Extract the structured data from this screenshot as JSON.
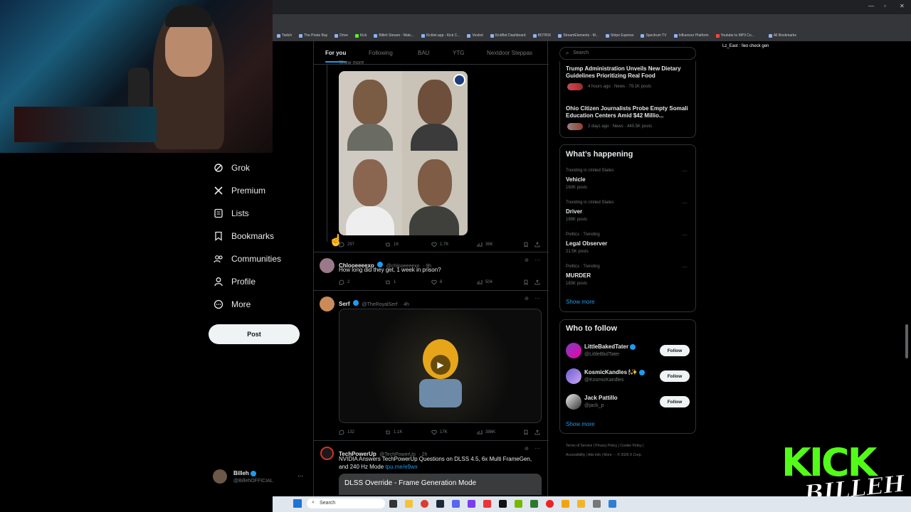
{
  "browser": {
    "bookmarks": [
      "Twitch",
      "The Pirate Bay",
      "Drive",
      "Kick",
      "Billeh Stream - Watc...",
      "Kicklet.app - Kick C...",
      "Voxbot",
      "KickBot Dashboard",
      "BOTRIX",
      "StreamElements - M...",
      "Stripe Express",
      "Spectrum TV",
      "Influencer Platform",
      "Youtube to MP3 Co..."
    ],
    "all_bookmarks": "All Bookmarks"
  },
  "chat": {
    "line": "Lz_East : !leo check gen"
  },
  "nav": {
    "items": [
      {
        "label": "Grok",
        "icon": "grok-icon"
      },
      {
        "label": "Premium",
        "icon": "x-logo-icon"
      },
      {
        "label": "Lists",
        "icon": "list-icon"
      },
      {
        "label": "Bookmarks",
        "icon": "bookmark-icon"
      },
      {
        "label": "Communities",
        "icon": "communities-icon"
      },
      {
        "label": "Profile",
        "icon": "profile-icon"
      },
      {
        "label": "More",
        "icon": "more-circle-icon"
      }
    ],
    "post_label": "Post",
    "profile": {
      "name": "Billeh",
      "handle": "@BillehOFFICIAL"
    }
  },
  "tabs": [
    "For you",
    "Following",
    "BAU",
    "YTG",
    "Nextdoor Steppas"
  ],
  "posts": {
    "first": {
      "show_more": "Show more",
      "replies": "297",
      "reposts": "1K",
      "likes": "1.7K",
      "views": "36K"
    },
    "second": {
      "name": "Chlooeeeexo",
      "handle": "@chlooeeeexo",
      "time": "· 9h",
      "text": "How long did they get, 1 week in prison?",
      "replies": "2",
      "reposts": "1",
      "likes": "6",
      "views": "504"
    },
    "third": {
      "name": "Serf",
      "handle": "@TheRoyalSerf",
      "time": "· 4h",
      "replies": "132",
      "reposts": "1.1K",
      "likes": "17K",
      "views": "386K"
    },
    "fourth": {
      "name": "TechPowerUp",
      "handle": "@TechPowerUp",
      "time": "· 2h",
      "text": "NVIDIA Answers TechPowerUp Questions on DLSS 4.5, 6x Multi FrameGen, and 240 Hz Mode",
      "link": "tpu.me/e9wx",
      "card": "DLSS Override - Frame Generation Mode"
    }
  },
  "search": {
    "placeholder": "Search"
  },
  "news": [
    {
      "title": "Trump Administration Unveils New Dietary Guidelines Prioritizing Real Food",
      "meta": "4 hours ago · News · 79.1K posts"
    },
    {
      "title": "Ohio Citizen Journalists Probe Empty Somali Education Centers Amid $42 Millio...",
      "meta": "2 days ago · News · 440.5K posts"
    }
  ],
  "happening": {
    "title": "What’s happening",
    "trends": [
      {
        "meta": "Trending in United States",
        "name": "Vehicle",
        "posts": "160K posts"
      },
      {
        "meta": "Trending in United States",
        "name": "Driver",
        "posts": "199K posts"
      },
      {
        "meta": "Politics · Trending",
        "name": "Legal Observer",
        "posts": "21.5K posts"
      },
      {
        "meta": "Politics · Trending",
        "name": "MURDER",
        "posts": "183K posts"
      }
    ],
    "show_more": "Show more"
  },
  "follow": {
    "title": "Who to follow",
    "users": [
      {
        "name": "LittleBakedTater",
        "handle": "@LittleBkdTater"
      },
      {
        "name": "KosmicKandles 🕯✨",
        "handle": "@KosmicKandles"
      },
      {
        "name": "Jack Pattillo",
        "handle": "@jack_p"
      }
    ],
    "button": "Follow",
    "show_more": "Show more"
  },
  "footer": {
    "line1": "Terms of Service | Privacy Policy | Cookie Policy |",
    "line2": "Accessibility | Ads info | More ··· © 2026 X Corp."
  },
  "overlay": {
    "kick": "KICK",
    "billeh": "BILLEH"
  },
  "taskbar": {
    "search": "Search"
  }
}
